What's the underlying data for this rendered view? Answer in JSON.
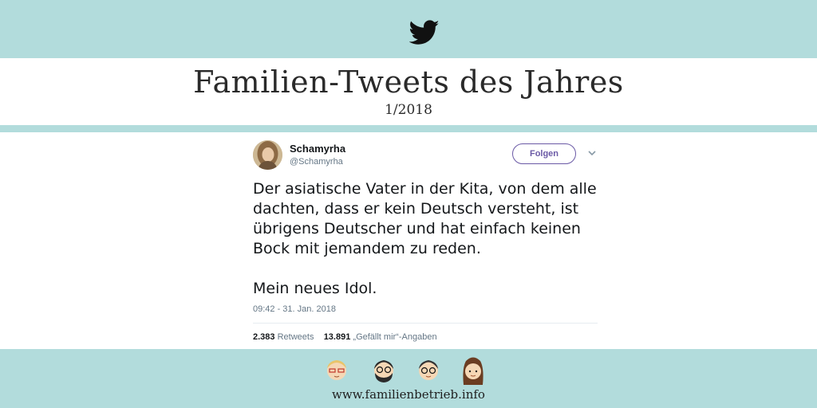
{
  "header": {
    "title": "Familien-Tweets des Jahres",
    "subtitle": "1/2018",
    "logo_icon": "twitter-bird-icon"
  },
  "tweet": {
    "author_name": "Schamyrha",
    "author_handle": "@Schamyrha",
    "follow_label": "Folgen",
    "text_paragraph_1": "Der asiatische Vater in der Kita, von dem alle dachten, dass er kein Deutsch versteht, ist übrigens Deutscher und hat einfach keinen Bock mit jemandem zu reden.",
    "text_paragraph_2": "Mein neues Idol.",
    "timestamp": "09:42 - 31. Jan. 2018",
    "retweets_count": "2.383",
    "retweets_label": "Retweets",
    "likes_count": "13.891",
    "likes_label": "„Gefällt mir“-Angaben"
  },
  "footer": {
    "url": "www.familienbetrieb.info"
  },
  "colors": {
    "band": "#b2dcdc",
    "accent": "#6b5aa6",
    "text": "#14171a",
    "muted": "#657786"
  }
}
